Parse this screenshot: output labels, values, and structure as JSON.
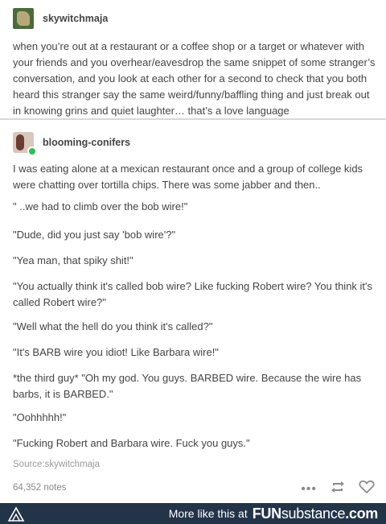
{
  "post1": {
    "username": "skywitchmaja",
    "body": "when you’re out at a restaurant or a coffee shop or a target or whatever with your friends and you overhear/eavesdrop the same snippet of some stranger’s conversation, and you look at each other for a second to check that you both heard this stranger say the same weird/funny/baffling thing and just break out in knowing grins and quiet laughter… that’s a love language"
  },
  "post2": {
    "username": "blooming-conifers",
    "paragraphs": [
      "I was eating alone at a mexican restaurant once and a group of college kids were chatting over tortilla chips. There was some jabber and then..",
      "\" ..we had to climb over the bob wire!\"",
      "\"Dude, did you just say 'bob wire'?\"",
      "\"Yea man, that spiky shit!\"",
      "\"You actually think it's called bob wire? Like fucking Robert wire? You think it's called Robert wire?\"",
      "\"Well what the hell do you think it's called?\"",
      "\"It's BARB wire you idiot! Like Barbara wire!\"",
      "*the third guy* \"Oh my god. You guys. BARBED wire. Because the wire has barbs, it is BARBED.\"",
      "\"Oohhhhh!\"",
      "\"Fucking Robert and Barbara wire. Fuck you guys.\""
    ]
  },
  "source": "Source:skywitchmaja",
  "notes": "64,352 notes",
  "icons": {
    "more": "ellipsis-icon",
    "reblog": "reblog-icon",
    "like": "heart-icon"
  },
  "footer": {
    "text": "More like this at",
    "brand_bold": "FUN",
    "brand_rest": "substance",
    "brand_tld": ".com"
  },
  "colors": {
    "footer_bg": "#233449",
    "text": "#444444",
    "muted": "#999999"
  }
}
